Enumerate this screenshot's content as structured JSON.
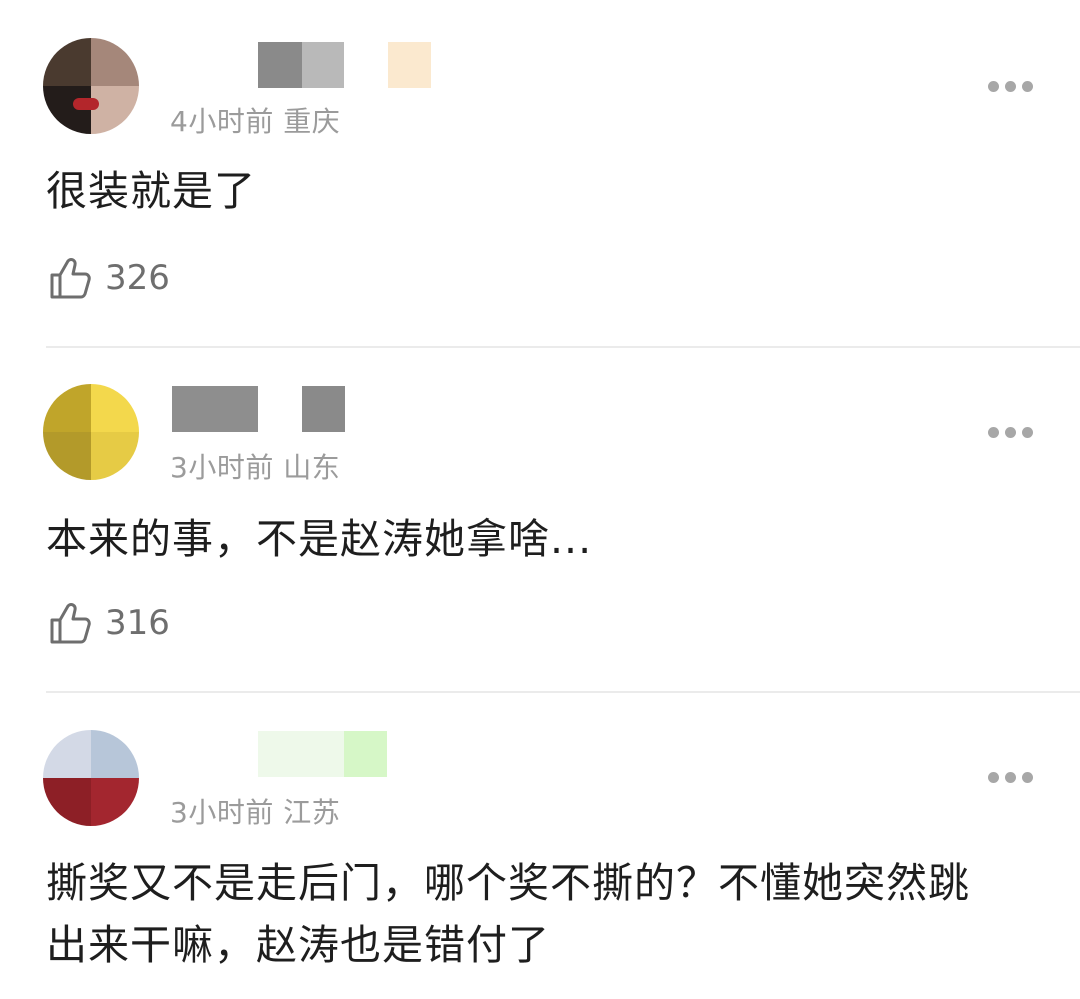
{
  "comments": [
    {
      "time": "4小时前",
      "location": "重庆",
      "text": "很装就是了",
      "likes": "326",
      "avatar_colors": [
        "#5b4a3b",
        "#a5877a",
        "#2a2220",
        "#d8b5a8"
      ]
    },
    {
      "time": "3小时前",
      "location": "山东",
      "text": "本来的事，不是赵涛她拿啥...",
      "likes": "316",
      "avatar_colors": [
        "#c0a52a",
        "#f3d84c",
        "#b39a2a",
        "#e6cb45"
      ]
    },
    {
      "time": "3小时前",
      "location": "江苏",
      "text": "撕奖又不是走后门，哪个奖不撕的？不懂她突然跳出来干嘛，赵涛也是错付了",
      "avatar_colors": [
        "#cfd6e4",
        "#b9c8da",
        "#8d1f26",
        "#a3262f"
      ]
    }
  ],
  "icons": {
    "more": "more-dots-icon",
    "like": "thumbs-up-icon"
  }
}
